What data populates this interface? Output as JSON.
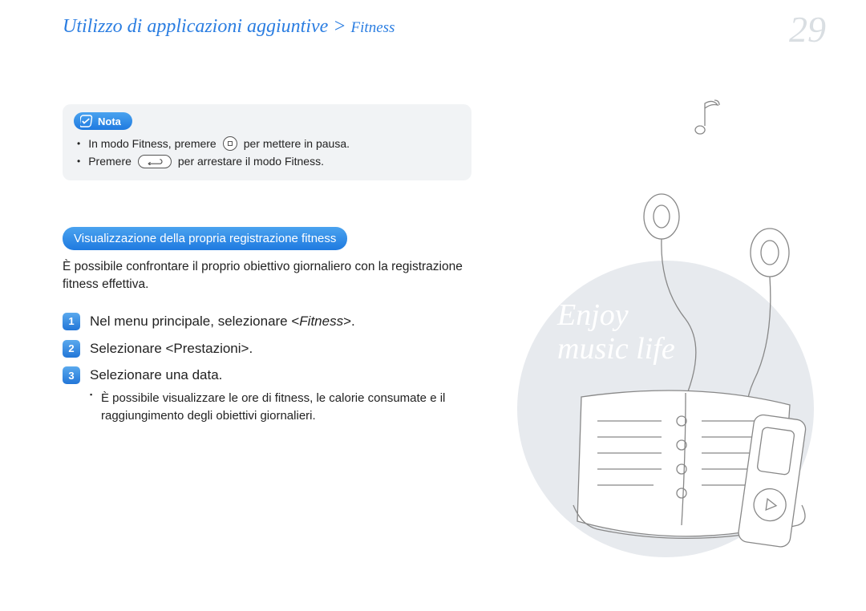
{
  "header": {
    "breadcrumb_main": "Utilizzo di applicazioni aggiuntive >",
    "breadcrumb_sub": "Fitness",
    "page_number": "29"
  },
  "nota": {
    "label": "Nota",
    "line1_pre": "In modo Fitness, premere",
    "line1_post": "per mettere in pausa.",
    "line2_pre": "Premere",
    "line2_post": "per arrestare il modo Fitness."
  },
  "section": {
    "pill": "Visualizzazione della propria registrazione fitness",
    "desc": "È possibile confrontare il proprio obiettivo giornaliero con la registrazione fitness effettiva."
  },
  "steps": [
    {
      "num": "1",
      "text_pre": "Nel menu principale, selezionare <",
      "text_em": "Fitness",
      "text_post": ">."
    },
    {
      "num": "2",
      "text_pre": "Selezionare <Prestazioni>.",
      "text_em": "",
      "text_post": ""
    },
    {
      "num": "3",
      "text_pre": "Selezionare una data.",
      "text_em": "",
      "text_post": "",
      "sub": "È possibile visualizzare le ore di fitness, le calorie consumate e il raggiungimento degli obiettivi giornalieri."
    }
  ],
  "illustration": {
    "enjoy1": "Enjoy",
    "enjoy2": "music life"
  }
}
